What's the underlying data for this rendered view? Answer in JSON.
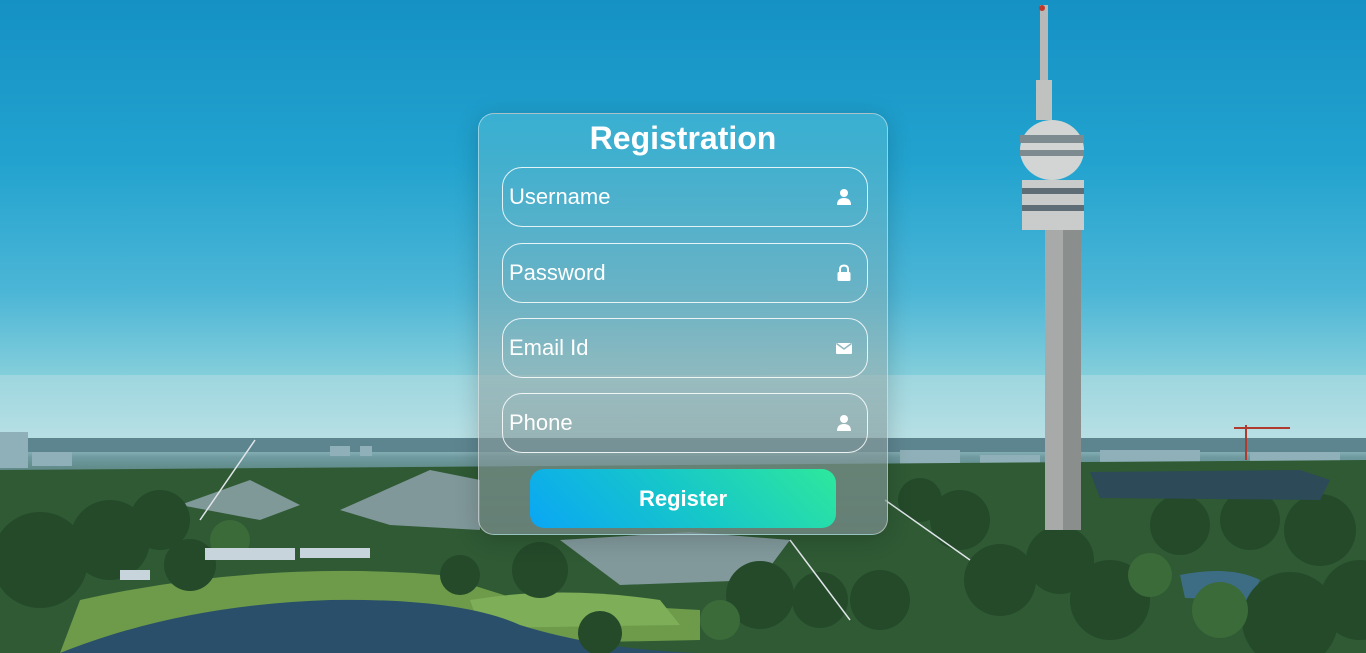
{
  "form": {
    "title": "Registration",
    "fields": [
      {
        "placeholder": "Username",
        "icon": "user-icon"
      },
      {
        "placeholder": "Password",
        "icon": "lock-icon"
      },
      {
        "placeholder": "Email Id",
        "icon": "envelope-icon"
      },
      {
        "placeholder": "Phone",
        "icon": "user-icon"
      }
    ],
    "submit_label": "Register"
  },
  "colors": {
    "button_gradient_start": "#0aa6f5",
    "button_gradient_end": "#2ee89c",
    "text": "#ffffff"
  },
  "background": {
    "description_icon": "city-skyline-with-tv-tower"
  }
}
